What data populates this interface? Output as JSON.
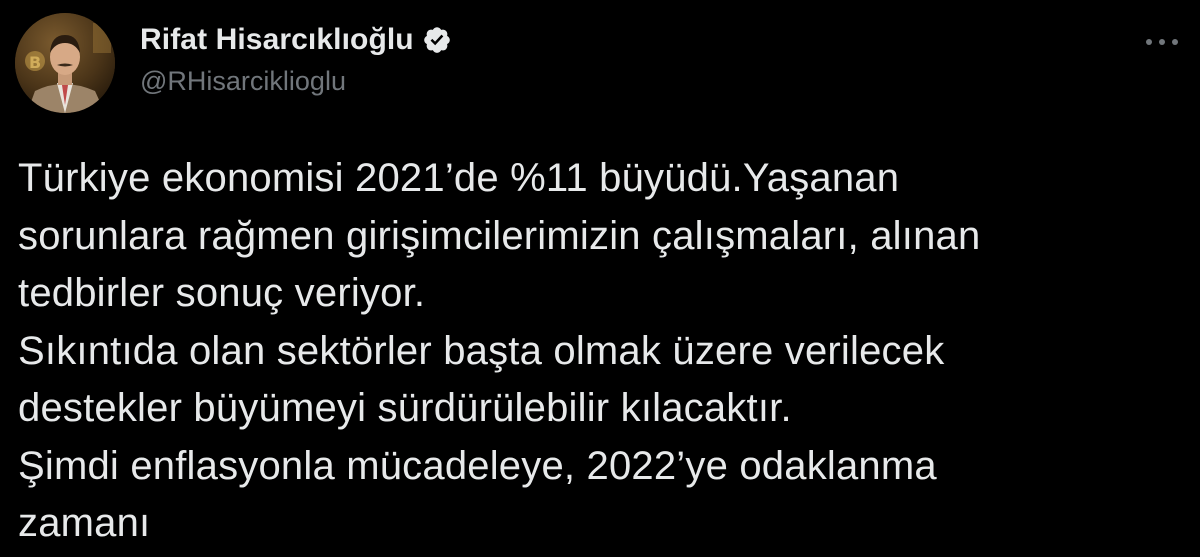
{
  "tweet": {
    "author": {
      "display_name": "Rifat Hisarcıklıoğlu",
      "handle": "@RHisarciklioglu",
      "verified": true,
      "avatar_icon": "profile-photo"
    },
    "more_icon": "more-horizontal-icon",
    "text": "Türkiye ekonomisi 2021’de %11 büyüdü.Yaşanan\nsorunlara rağmen girişimcilerimizin çalışmaları, alınan\ntedbirler sonuç veriyor.\nSıkıntıda olan sektörler başta olmak üzere verilecek\ndestekler büyümeyi sürdürülebilir kılacaktır.\nŞimdi enflasyonla mücadeleye, 2022’ye odaklanma\nzamanı"
  },
  "colors": {
    "background": "#000000",
    "text_primary": "#e7e9ea",
    "text_secondary": "#71767b",
    "verified_badge": "#e7e9ea"
  }
}
